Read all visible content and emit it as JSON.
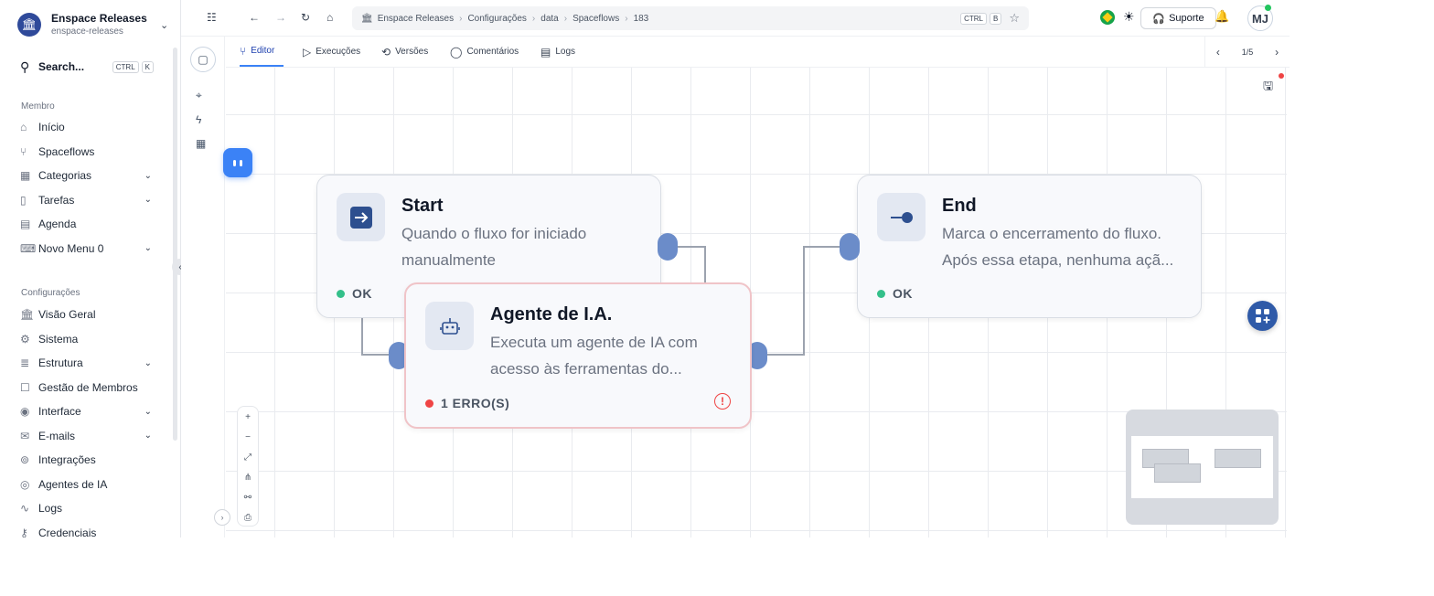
{
  "workspace": {
    "name": "Enspace Releases",
    "slug": "enspace-releases"
  },
  "search": {
    "label": "Search...",
    "kbd": [
      "CTRL",
      "K"
    ]
  },
  "sidebar": {
    "member_label": "Membro",
    "member_items": [
      {
        "label": "Início",
        "icon": "home-icon"
      },
      {
        "label": "Spaceflows",
        "icon": "flow-icon"
      },
      {
        "label": "Categorias",
        "icon": "grid-icon",
        "chevron": true
      },
      {
        "label": "Tarefas",
        "icon": "file-icon",
        "chevron": true
      },
      {
        "label": "Agenda",
        "icon": "calendar-icon"
      },
      {
        "label": "Novo Menu 0",
        "icon": "keyboard-icon",
        "chevron": true
      }
    ],
    "config_label": "Configurações",
    "config_items": [
      {
        "label": "Visão Geral",
        "icon": "bank-icon"
      },
      {
        "label": "Sistema",
        "icon": "gear-icon"
      },
      {
        "label": "Estrutura",
        "icon": "database-icon",
        "chevron": true
      },
      {
        "label": "Gestão de Membros",
        "icon": "member-icon"
      },
      {
        "label": "Interface",
        "icon": "compass-icon",
        "chevron": true
      },
      {
        "label": "E-mails",
        "icon": "mail-icon",
        "chevron": true
      },
      {
        "label": "Integrações",
        "icon": "link-icon"
      },
      {
        "label": "Agentes de IA",
        "icon": "ai-icon"
      },
      {
        "label": "Logs",
        "icon": "pulse-icon"
      },
      {
        "label": "Credenciais",
        "icon": "key-icon"
      }
    ]
  },
  "breadcrumb": [
    "Enspace Releases",
    "Configurações",
    "data",
    "Spaceflows",
    "183"
  ],
  "breadcrumb_kbd": [
    "CTRL",
    "B"
  ],
  "header": {
    "support": "Suporte",
    "avatar": "MJ"
  },
  "tabs": [
    {
      "label": "Editor",
      "icon": "flow-icon",
      "active": true
    },
    {
      "label": "Execuções",
      "icon": "play-icon"
    },
    {
      "label": "Versões",
      "icon": "history-icon"
    },
    {
      "label": "Comentários",
      "icon": "comment-icon"
    },
    {
      "label": "Logs",
      "icon": "logs-icon"
    }
  ],
  "pager": "1/5",
  "nodes": {
    "start": {
      "title": "Start",
      "desc": "Quando o fluxo for iniciado manualmente",
      "status": "OK",
      "status_color": "#34c08a"
    },
    "end": {
      "title": "End",
      "desc": "Marca o encerramento do fluxo. Após essa etapa, nenhuma açã...",
      "status": "OK",
      "status_color": "#34c08a"
    },
    "agent": {
      "title": "Agente de I.A.",
      "desc": "Executa um agente de IA com acesso às ferramentas do...",
      "status": "1 ERRO(S)",
      "status_color": "#ef4444"
    }
  },
  "zoom_controls": [
    "+",
    "−",
    "⤢",
    "⋔",
    "⚯",
    "⎙"
  ],
  "colors": {
    "accent": "#3b82f6",
    "handle": "#6b8cc9",
    "brand": "#2f4a9a",
    "error": "#ef4444",
    "ok": "#34c08a"
  }
}
